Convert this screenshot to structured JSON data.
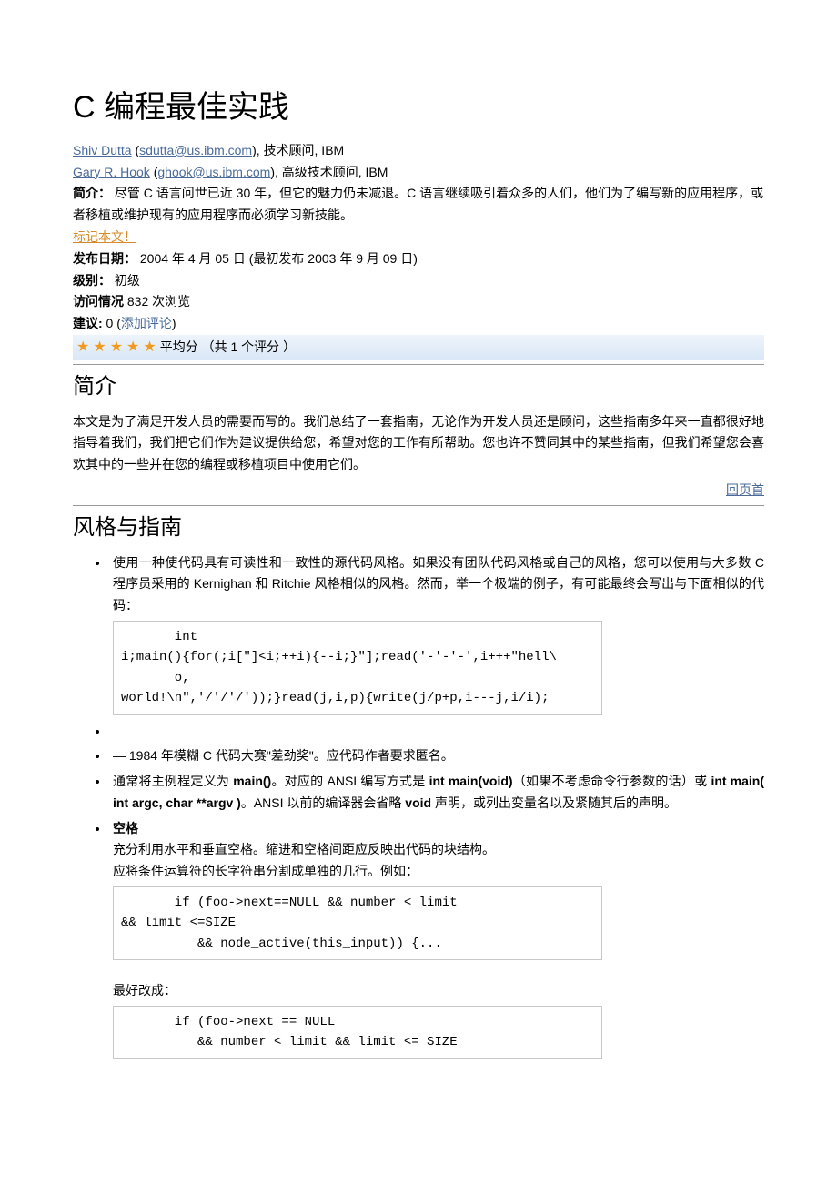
{
  "title": "C 编程最佳实践",
  "authors": [
    {
      "name": "Shiv Dutta",
      "email": "sdutta@us.ibm.com",
      "role": "技术顾问, IBM"
    },
    {
      "name": "Gary R. Hook",
      "email": "ghook@us.ibm.com",
      "role": "高级技术顾问, IBM"
    }
  ],
  "summary": {
    "label": "简介：",
    "text": " 尽管 C 语言问世已近 30 年，但它的魅力仍未减退。C 语言继续吸引着众多的人们，他们为了编写新的应用程序，或者移植或维护现有的应用程序而必须学习新技能。"
  },
  "bookmark": "标记本文！",
  "pubdate": {
    "label": "发布日期：",
    "text": " 2004 年 4 月 05 日 (最初发布 2003 年 9 月 09 日)"
  },
  "level": {
    "label": "级别：",
    "text": " 初级"
  },
  "views": {
    "label": "访问情况",
    "text": " 832 次浏览"
  },
  "suggest": {
    "label": "建议:",
    "count": " 0 (",
    "link": "添加评论",
    "close": ")"
  },
  "rating": {
    "text": "平均分 （共 1 个评分 ）"
  },
  "sections": {
    "intro": {
      "heading": "简介",
      "body": "本文是为了满足开发人员的需要而写的。我们总结了一套指南，无论作为开发人员还是顾问，这些指南多年来一直都很好地指导着我们，我们把它们作为建议提供给您，希望对您的工作有所帮助。您也许不赞同其中的某些指南，但我们希望您会喜欢其中的一些并在您的编程或移植项目中使用它们。"
    },
    "toplink": "回页首",
    "style": {
      "heading": "风格与指南",
      "bullets": {
        "b1": "使用一种使代码具有可读性和一致性的源代码风格。如果没有团队代码风格或自己的风格，您可以使用与大多数 C 程序员采用的 Kernighan 和 Ritchie 风格相似的风格。然而，举一个极端的例子，有可能最终会写出与下面相似的代码：",
        "code1": "       int\ni;main(){for(;i[\"]<i;++i){--i;}\"];read('-'-'-',i+++\"hell\\\n       o,\nworld!\\n\",'/'/'/'));}read(j,i,p){write(j/p+p,i---j,i/i);",
        "b2_pre": "— 1984 年模糊 C 代码大赛\"差劲奖\"。应代码作者要求匿名。",
        "b3_a": "通常将主例程定义为 ",
        "b3_main1": "main()",
        "b3_b": "。对应的 ANSI 编写方式是 ",
        "b3_main2": "int main(void)",
        "b3_c": "（如果不考虑命令行参数的话）或 ",
        "b3_main3": "int main( int argc, char **argv )",
        "b3_d": "。ANSI 以前的编译器会省略 ",
        "b3_void": "void",
        "b3_e": " 声明，或列出变量名以及紧随其后的声明。",
        "b4_head": "空格",
        "b4_l1": "充分利用水平和垂直空格。缩进和空格间距应反映出代码的块结构。",
        "b4_l2": "应将条件运算符的长字符串分割成单独的几行。例如：",
        "code2": "       if (foo->next==NULL && number < limit\n&& limit <=SIZE\n          && node_active(this_input)) {...",
        "better": "最好改成：",
        "code3": "       if (foo->next == NULL\n          && number < limit && limit <= SIZE"
      }
    }
  }
}
